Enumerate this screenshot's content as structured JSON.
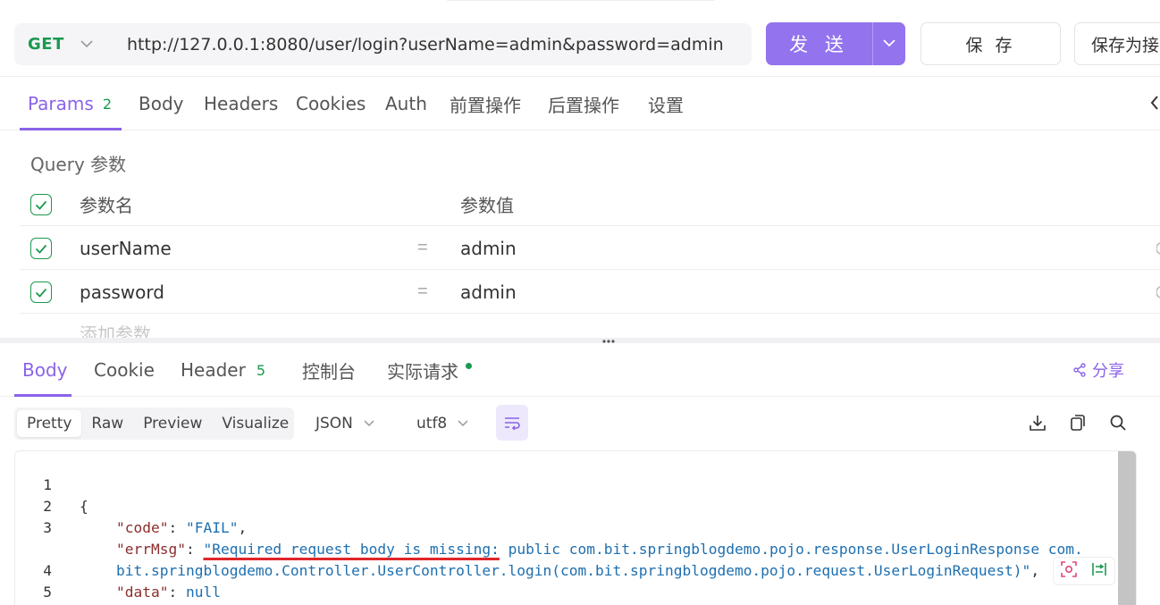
{
  "request": {
    "method": "GET",
    "url": "http://127.0.0.1:8080/user/login?userName=admin&password=admin",
    "send_label": "发 送",
    "save_label": "保 存",
    "save_as_label": "保存为接"
  },
  "request_tabs": [
    {
      "label": "Params",
      "count": "2"
    },
    {
      "label": "Body"
    },
    {
      "label": "Headers"
    },
    {
      "label": "Cookies"
    },
    {
      "label": "Auth"
    },
    {
      "label": "前置操作"
    },
    {
      "label": "后置操作"
    },
    {
      "label": "设置"
    }
  ],
  "query": {
    "title": "Query 参数",
    "header": {
      "name": "参数名",
      "value": "参数值"
    },
    "params": [
      {
        "name": "userName",
        "eq": "=",
        "value": "admin"
      },
      {
        "name": "password",
        "eq": "=",
        "value": "admin"
      }
    ],
    "add_label": "添加参数"
  },
  "response_tabs": [
    {
      "label": "Body"
    },
    {
      "label": "Cookie"
    },
    {
      "label": "Header",
      "count": "5"
    },
    {
      "label": "控制台"
    },
    {
      "label": "实际请求"
    }
  ],
  "share_label": "分享",
  "view_modes": [
    "Pretty",
    "Raw",
    "Preview",
    "Visualize"
  ],
  "format": "JSON",
  "encoding": "utf8",
  "code": {
    "line_numbers": [
      "1",
      "2",
      "3",
      "",
      "4",
      "5"
    ],
    "open_brace": "{",
    "close_brace": "}",
    "code_key": "\"code\"",
    "code_val": "\"FAIL\"",
    "err_key": "\"errMsg\"",
    "err_val_underlined": "\"Required request body is missing:",
    "err_val_rest1": " public com.bit.springblogdemo.pojo.response.UserLoginResponse com.",
    "err_val_rest2": "bit.springblogdemo.Controller.UserController.login(com.bit.springblogdemo.pojo.request.UserLoginRequest)\"",
    "data_key": "\"data\"",
    "data_val": "null"
  },
  "colors": {
    "accent": "#8a63e8",
    "send_button": "#9373ee",
    "method_get": "#1a9a4f",
    "underline": "#e0252b"
  }
}
